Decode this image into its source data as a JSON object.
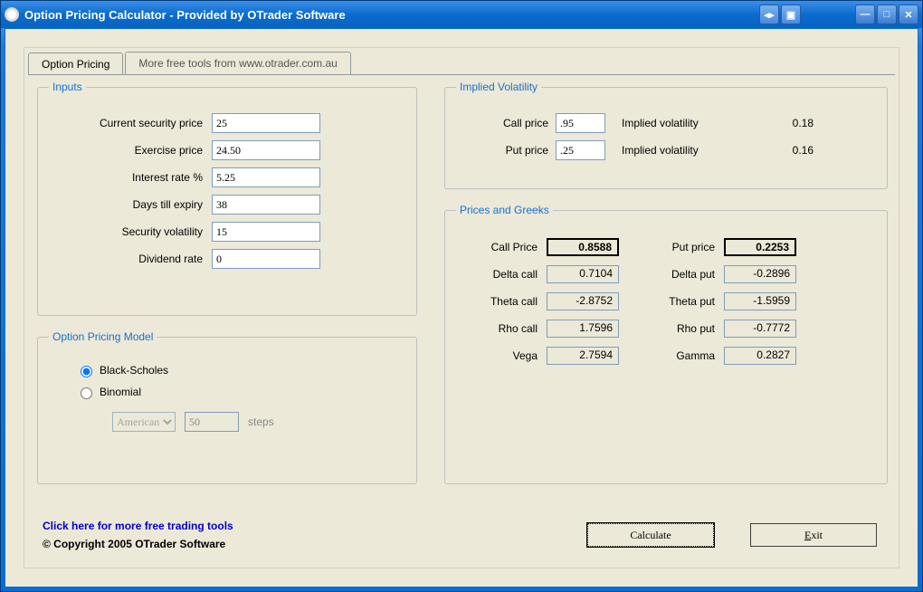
{
  "window": {
    "title": "Option Pricing Calculator - Provided by OTrader Software"
  },
  "tabs": [
    {
      "label": "Option Pricing",
      "active": true
    },
    {
      "label": "More free tools from www.otrader.com.au",
      "active": false
    }
  ],
  "inputs": {
    "legend": "Inputs",
    "fields": {
      "current_price": {
        "label": "Current security price",
        "value": "25"
      },
      "exercise_price": {
        "label": "Exercise price",
        "value": "24.50"
      },
      "interest_rate": {
        "label": "Interest rate %",
        "value": "5.25"
      },
      "days_expiry": {
        "label": "Days till expiry",
        "value": "38"
      },
      "volatility": {
        "label": "Security volatility",
        "value": "15"
      },
      "dividend_rate": {
        "label": "Dividend rate",
        "value": "0"
      }
    }
  },
  "model": {
    "legend": "Option Pricing Model",
    "options": {
      "black_scholes": {
        "label": "Black-Scholes",
        "selected": true
      },
      "binomial": {
        "label": "Binomial",
        "selected": false
      }
    },
    "binomial_type": "American",
    "steps_label": "steps",
    "steps_value": "50"
  },
  "iv": {
    "legend": "Implied Volatility",
    "call": {
      "label": "Call price",
      "value": ".95",
      "result_label": "Implied volatility",
      "result": "0.18"
    },
    "put": {
      "label": "Put price",
      "value": ".25",
      "result_label": "Implied volatility",
      "result": "0.16"
    }
  },
  "greeks": {
    "legend": "Prices and Greeks",
    "rows": [
      {
        "l1": "Call Price",
        "v1": "0.8588",
        "l2": "Put price",
        "v2": "0.2253",
        "bold": true
      },
      {
        "l1": "Delta call",
        "v1": "0.7104",
        "l2": "Delta put",
        "v2": "-0.2896"
      },
      {
        "l1": "Theta call",
        "v1": "-2.8752",
        "l2": "Theta put",
        "v2": "-1.5959"
      },
      {
        "l1": "Rho call",
        "v1": "1.7596",
        "l2": "Rho put",
        "v2": "-0.7772"
      },
      {
        "l1": "Vega",
        "v1": "2.7594",
        "l2": "Gamma",
        "v2": "0.2827"
      }
    ]
  },
  "footer": {
    "link": "Click here for more free trading tools",
    "copyright": "© Copyright 2005 OTrader Software"
  },
  "buttons": {
    "calculate": "Calculate",
    "exit": "Exit"
  }
}
